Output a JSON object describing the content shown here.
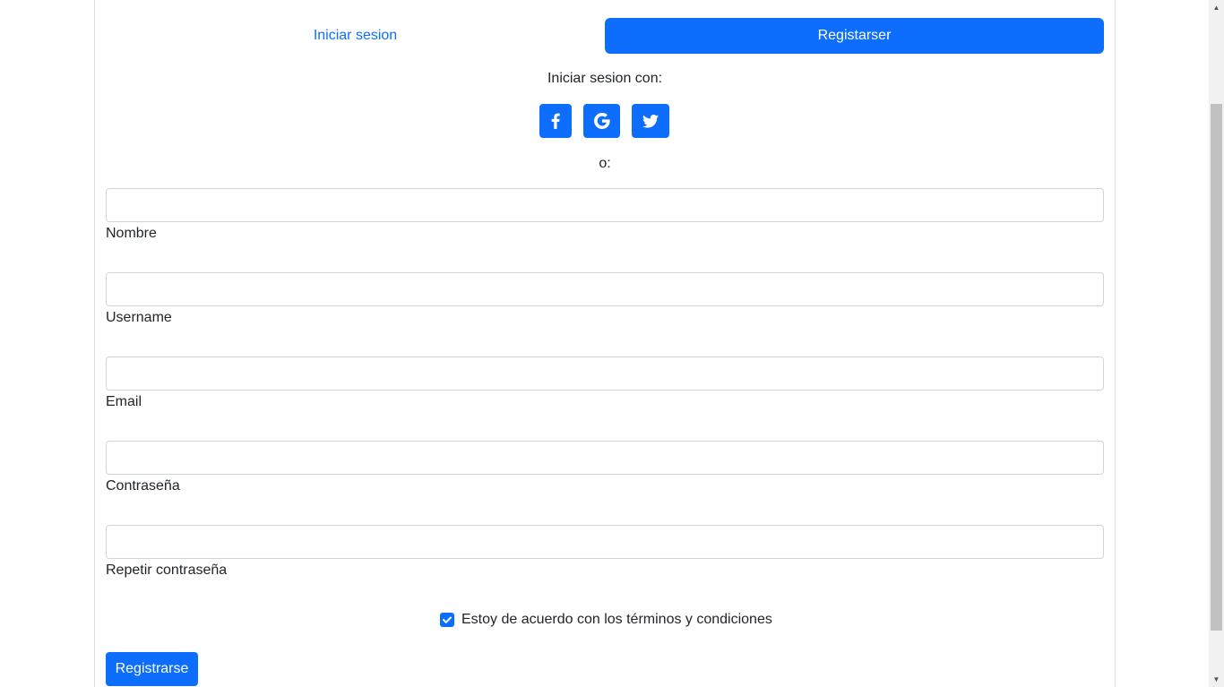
{
  "tabs": {
    "login": "Iniciar sesion",
    "register": "Registarser"
  },
  "social": {
    "heading": "Iniciar sesion con:",
    "buttons": [
      "facebook-icon",
      "google-icon",
      "twitter-icon"
    ]
  },
  "divider_text": "o:",
  "form": {
    "fields": [
      {
        "label": "Nombre",
        "value": ""
      },
      {
        "label": "Username",
        "value": ""
      },
      {
        "label": "Email",
        "value": ""
      },
      {
        "label": "Contraseña",
        "value": ""
      },
      {
        "label": "Repetir contraseña",
        "value": ""
      }
    ],
    "terms_label": "Estoy de acuerdo con los términos y condiciones",
    "terms_checked": true,
    "submit_label": "Registrarse"
  },
  "colors": {
    "primary": "#0d6efd",
    "border": "#ced4da",
    "text": "#212529"
  }
}
